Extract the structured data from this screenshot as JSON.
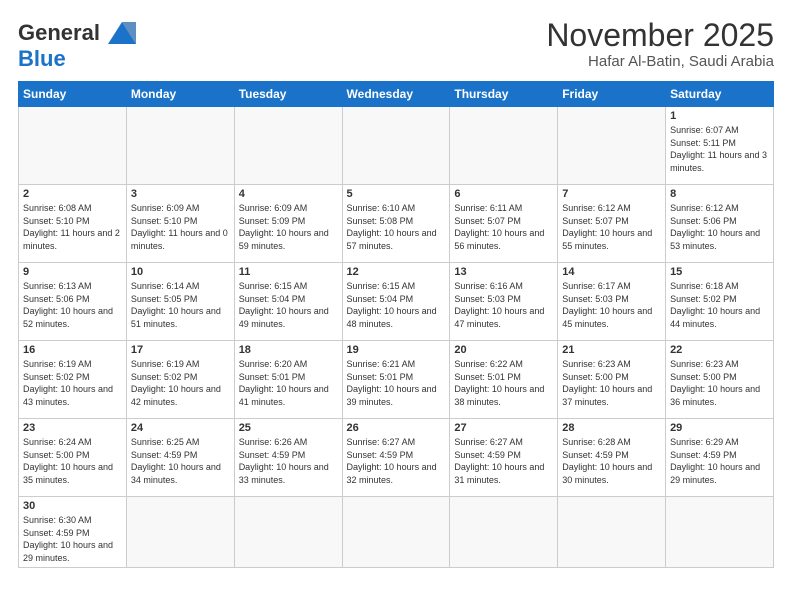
{
  "logo": {
    "text_general": "General",
    "text_blue": "Blue"
  },
  "title": {
    "month_year": "November 2025",
    "location": "Hafar Al-Batin, Saudi Arabia"
  },
  "weekdays": [
    "Sunday",
    "Monday",
    "Tuesday",
    "Wednesday",
    "Thursday",
    "Friday",
    "Saturday"
  ],
  "weeks": [
    [
      {
        "day": "",
        "info": ""
      },
      {
        "day": "",
        "info": ""
      },
      {
        "day": "",
        "info": ""
      },
      {
        "day": "",
        "info": ""
      },
      {
        "day": "",
        "info": ""
      },
      {
        "day": "",
        "info": ""
      },
      {
        "day": "1",
        "info": "Sunrise: 6:07 AM\nSunset: 5:11 PM\nDaylight: 11 hours and 3 minutes."
      }
    ],
    [
      {
        "day": "2",
        "info": "Sunrise: 6:08 AM\nSunset: 5:10 PM\nDaylight: 11 hours and 2 minutes."
      },
      {
        "day": "3",
        "info": "Sunrise: 6:09 AM\nSunset: 5:10 PM\nDaylight: 11 hours and 0 minutes."
      },
      {
        "day": "4",
        "info": "Sunrise: 6:09 AM\nSunset: 5:09 PM\nDaylight: 10 hours and 59 minutes."
      },
      {
        "day": "5",
        "info": "Sunrise: 6:10 AM\nSunset: 5:08 PM\nDaylight: 10 hours and 57 minutes."
      },
      {
        "day": "6",
        "info": "Sunrise: 6:11 AM\nSunset: 5:07 PM\nDaylight: 10 hours and 56 minutes."
      },
      {
        "day": "7",
        "info": "Sunrise: 6:12 AM\nSunset: 5:07 PM\nDaylight: 10 hours and 55 minutes."
      },
      {
        "day": "8",
        "info": "Sunrise: 6:12 AM\nSunset: 5:06 PM\nDaylight: 10 hours and 53 minutes."
      }
    ],
    [
      {
        "day": "9",
        "info": "Sunrise: 6:13 AM\nSunset: 5:06 PM\nDaylight: 10 hours and 52 minutes."
      },
      {
        "day": "10",
        "info": "Sunrise: 6:14 AM\nSunset: 5:05 PM\nDaylight: 10 hours and 51 minutes."
      },
      {
        "day": "11",
        "info": "Sunrise: 6:15 AM\nSunset: 5:04 PM\nDaylight: 10 hours and 49 minutes."
      },
      {
        "day": "12",
        "info": "Sunrise: 6:15 AM\nSunset: 5:04 PM\nDaylight: 10 hours and 48 minutes."
      },
      {
        "day": "13",
        "info": "Sunrise: 6:16 AM\nSunset: 5:03 PM\nDaylight: 10 hours and 47 minutes."
      },
      {
        "day": "14",
        "info": "Sunrise: 6:17 AM\nSunset: 5:03 PM\nDaylight: 10 hours and 45 minutes."
      },
      {
        "day": "15",
        "info": "Sunrise: 6:18 AM\nSunset: 5:02 PM\nDaylight: 10 hours and 44 minutes."
      }
    ],
    [
      {
        "day": "16",
        "info": "Sunrise: 6:19 AM\nSunset: 5:02 PM\nDaylight: 10 hours and 43 minutes."
      },
      {
        "day": "17",
        "info": "Sunrise: 6:19 AM\nSunset: 5:02 PM\nDaylight: 10 hours and 42 minutes."
      },
      {
        "day": "18",
        "info": "Sunrise: 6:20 AM\nSunset: 5:01 PM\nDaylight: 10 hours and 41 minutes."
      },
      {
        "day": "19",
        "info": "Sunrise: 6:21 AM\nSunset: 5:01 PM\nDaylight: 10 hours and 39 minutes."
      },
      {
        "day": "20",
        "info": "Sunrise: 6:22 AM\nSunset: 5:01 PM\nDaylight: 10 hours and 38 minutes."
      },
      {
        "day": "21",
        "info": "Sunrise: 6:23 AM\nSunset: 5:00 PM\nDaylight: 10 hours and 37 minutes."
      },
      {
        "day": "22",
        "info": "Sunrise: 6:23 AM\nSunset: 5:00 PM\nDaylight: 10 hours and 36 minutes."
      }
    ],
    [
      {
        "day": "23",
        "info": "Sunrise: 6:24 AM\nSunset: 5:00 PM\nDaylight: 10 hours and 35 minutes."
      },
      {
        "day": "24",
        "info": "Sunrise: 6:25 AM\nSunset: 4:59 PM\nDaylight: 10 hours and 34 minutes."
      },
      {
        "day": "25",
        "info": "Sunrise: 6:26 AM\nSunset: 4:59 PM\nDaylight: 10 hours and 33 minutes."
      },
      {
        "day": "26",
        "info": "Sunrise: 6:27 AM\nSunset: 4:59 PM\nDaylight: 10 hours and 32 minutes."
      },
      {
        "day": "27",
        "info": "Sunrise: 6:27 AM\nSunset: 4:59 PM\nDaylight: 10 hours and 31 minutes."
      },
      {
        "day": "28",
        "info": "Sunrise: 6:28 AM\nSunset: 4:59 PM\nDaylight: 10 hours and 30 minutes."
      },
      {
        "day": "29",
        "info": "Sunrise: 6:29 AM\nSunset: 4:59 PM\nDaylight: 10 hours and 29 minutes."
      }
    ],
    [
      {
        "day": "30",
        "info": "Sunrise: 6:30 AM\nSunset: 4:59 PM\nDaylight: 10 hours and 29 minutes."
      },
      {
        "day": "",
        "info": ""
      },
      {
        "day": "",
        "info": ""
      },
      {
        "day": "",
        "info": ""
      },
      {
        "day": "",
        "info": ""
      },
      {
        "day": "",
        "info": ""
      },
      {
        "day": "",
        "info": ""
      }
    ]
  ]
}
